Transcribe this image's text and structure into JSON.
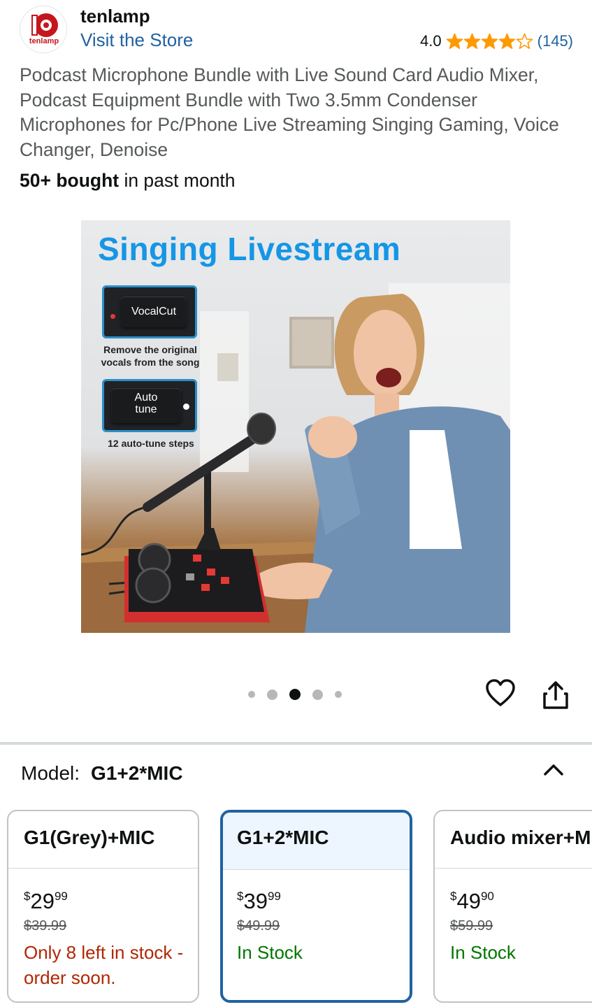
{
  "store": {
    "logo_text": "tenlamp",
    "brand": "tenlamp",
    "visit_link": "Visit the Store",
    "rating": "4.0",
    "stars_filled": 4,
    "stars_total": 5,
    "rating_count": "(145)"
  },
  "product": {
    "title": "Podcast Microphone Bundle with Live Sound Card Audio Mixer, Podcast Equipment Bundle with Two 3.5mm Condenser Microphones for Pc/Phone Live Streaming Singing Gaming, Voice Changer, Denoise",
    "bought_bold": "50+ bought",
    "bought_rest": " in past month"
  },
  "image": {
    "headline": "Singing Livestream",
    "feature1_button": "VocalCut",
    "feature1_note": "Remove the original vocals from the song",
    "feature2_button_line1": "Auto",
    "feature2_button_line2": "tune",
    "feature2_note": "12 auto-tune steps",
    "carousel_total": 5,
    "carousel_active": 3
  },
  "model": {
    "label": "Model:",
    "value": "G1+2*MIC"
  },
  "variants": [
    {
      "name": "G1(Grey)+MIC",
      "price_currency": "$",
      "price_whole": "29",
      "price_fraction": "99",
      "list_price": "$39.99",
      "stock": "Only 8 left in stock - order soon.",
      "selected": false
    },
    {
      "name": "G1+2*MIC",
      "price_currency": "$",
      "price_whole": "39",
      "price_fraction": "99",
      "list_price": "$49.99",
      "stock": "In Stock",
      "selected": true
    },
    {
      "name": "Audio mixer+MIC",
      "price_currency": "$",
      "price_whole": "49",
      "price_fraction": "90",
      "list_price": "$59.99",
      "stock": "In Stock",
      "selected": false
    }
  ],
  "colors": {
    "link_blue": "#2162a1",
    "star_orange": "#ff9900",
    "low_stock_red": "#b12704",
    "in_stock_green": "#007600",
    "headline_blue": "#1596e6"
  },
  "icons": [
    "tenlamp-logo",
    "star-icon",
    "heart-icon",
    "share-icon",
    "chevron-up-icon"
  ]
}
